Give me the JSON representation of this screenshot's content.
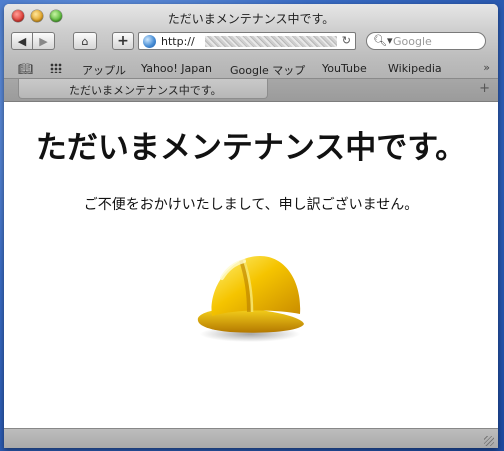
{
  "window": {
    "title": "ただいまメンテナンス中です。"
  },
  "toolbar": {
    "back_icon": "◀",
    "forward_icon": "▶",
    "home_icon": "⌂",
    "add_icon": "+",
    "url_prefix": "http://",
    "reload_icon": "↻",
    "search_icon": "🔍︎▾",
    "search_placeholder": "Google"
  },
  "bookmarks": {
    "book_icon": "📖︎",
    "items": [
      "アップル",
      "Yahoo! Japan",
      "Google マップ",
      "YouTube",
      "Wikipedia"
    ],
    "more_icon": "»"
  },
  "tab": {
    "label": "ただいまメンテナンス中です。",
    "new_tab_icon": "+"
  },
  "page": {
    "headline": "ただいまメンテナンス中です。",
    "message": "ご不便をおかけいたしまして、申し訳ございません。",
    "icon": "hard-hat-icon"
  },
  "colors": {
    "helmet_main": "#f5c400",
    "helmet_dark": "#c98c00",
    "helmet_light": "#fff27a"
  }
}
